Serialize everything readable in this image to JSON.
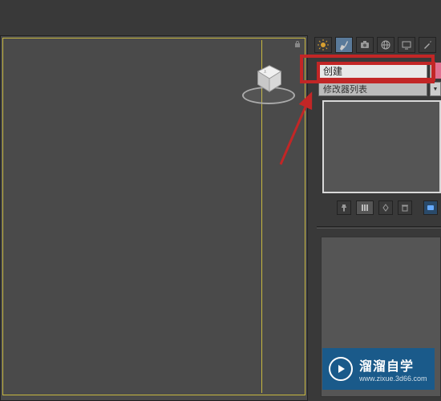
{
  "panel": {
    "create_label": "创建",
    "sub_label": "修改器列表"
  },
  "watermark": {
    "main": "溜溜自学",
    "sub": "www.zixue.3d66.com"
  },
  "icons": {
    "lock": "lock-icon",
    "sun": "sun-icon",
    "brush": "brush-icon",
    "camera": "camera-icon",
    "globe": "globe-icon",
    "monitor": "monitor-icon",
    "wand": "wand-icon"
  }
}
